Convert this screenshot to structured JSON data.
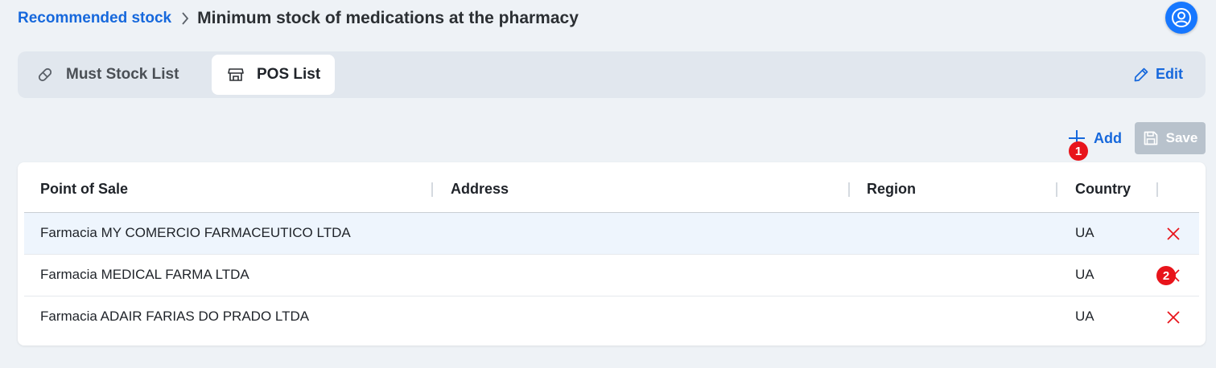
{
  "breadcrumb": {
    "link_label": "Recommended stock",
    "title": "Minimum stock of medications at the pharmacy"
  },
  "tabs": [
    {
      "label": "Must Stock List",
      "icon": "pill-icon",
      "active": false
    },
    {
      "label": "POS List",
      "icon": "store-icon",
      "active": true
    }
  ],
  "edit": {
    "label": "Edit",
    "icon": "pencil-icon"
  },
  "actions": {
    "add_label": "Add",
    "save_label": "Save",
    "save_disabled": true
  },
  "badges": [
    "1",
    "2"
  ],
  "table": {
    "columns": [
      "Point of Sale",
      "Address",
      "Region",
      "Country"
    ],
    "rows": [
      {
        "pos": "Farmacia MY COMERCIO FARMACEUTICO LTDA",
        "address": "",
        "region": "",
        "country": "UA",
        "selected": true
      },
      {
        "pos": "Farmacia MEDICAL FARMA LTDA",
        "address": "",
        "region": "",
        "country": "UA",
        "selected": false
      },
      {
        "pos": "Farmacia ADAIR FARIAS DO PRADO LTDA",
        "address": "",
        "region": "",
        "country": "UA",
        "selected": false
      }
    ]
  },
  "colors": {
    "accent": "#1668dc",
    "avatar_bg": "#1677ff",
    "delete": "#e8141b",
    "badge": "#e8141b",
    "save_disabled_bg": "#b8c2cc",
    "page_bg": "#eef2f6",
    "selected_row": "#eef5fd"
  }
}
